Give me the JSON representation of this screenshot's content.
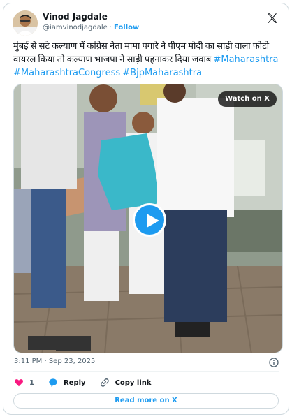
{
  "author": {
    "name": "Vinod Jagdale",
    "handle": "@iamvinodjagdale",
    "separator": "·",
    "follow_label": "Follow"
  },
  "tweet": {
    "text": "मुंबई से सटे कल्याण में कांग्रेस नेता मामा पगारे ने पीएम मोदी का साड़ी वाला फोटो वायरल किया तो कल्याण भाजपा ने साड़ी पहनाकर दिया जवाब",
    "hashtags": [
      "#Maharashtra",
      "#MaharashtraCongress",
      "#BjpMaharashtra"
    ]
  },
  "media": {
    "watch_label": "Watch on X",
    "play_icon": "play-icon"
  },
  "timestamp": "3:11 PM · Sep 23, 2025",
  "actions": {
    "like_count": "1",
    "reply_label": "Reply",
    "copy_link_label": "Copy link"
  },
  "read_more_label": "Read more on X",
  "colors": {
    "accent": "#1d9bf0",
    "like": "#f91880",
    "text": "#0f1419",
    "muted": "#536471"
  }
}
